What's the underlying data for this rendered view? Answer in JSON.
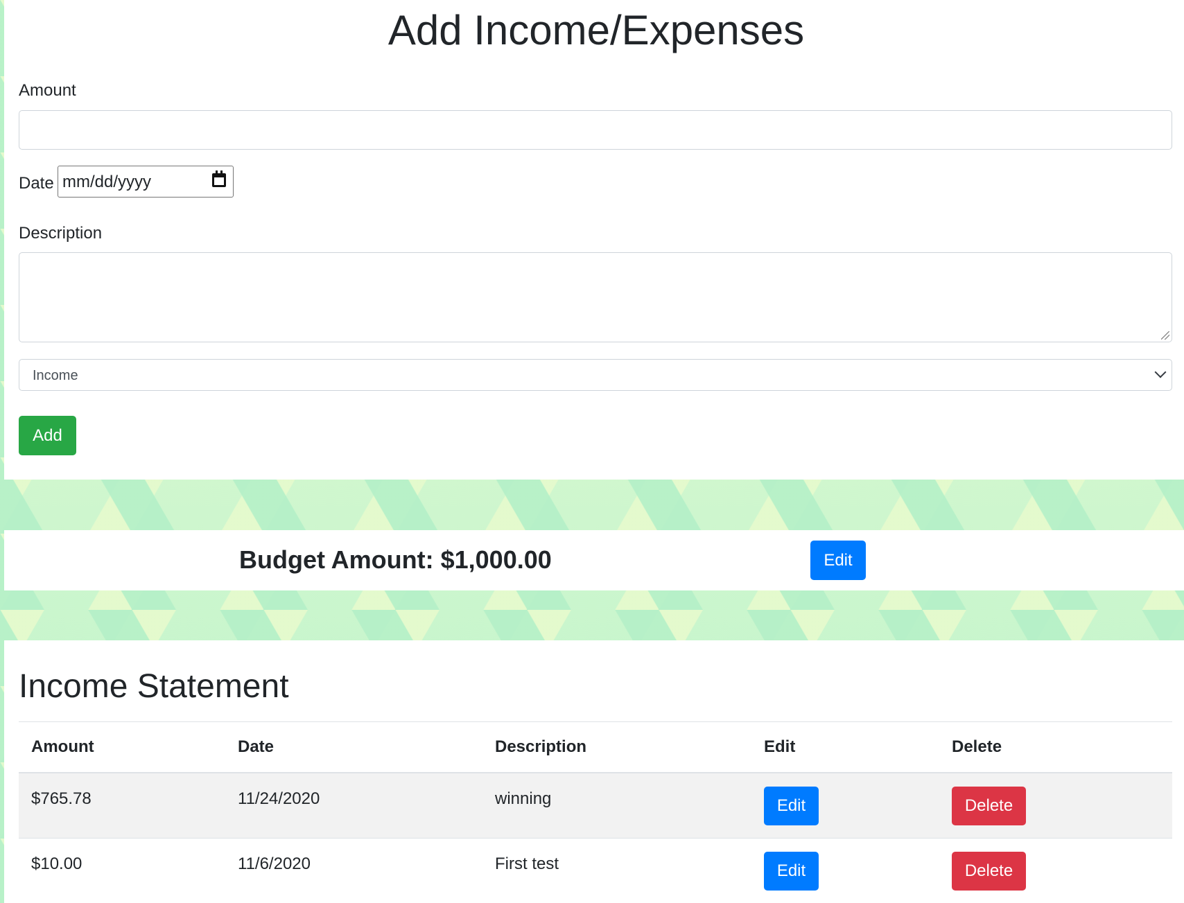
{
  "form": {
    "title": "Add Income/Expenses",
    "amount_label": "Amount",
    "amount_value": "",
    "date_label": "Date",
    "date_placeholder": "mm/dd/yyyy",
    "description_label": "Description",
    "description_value": "",
    "type_selected": "Income",
    "add_button": "Add"
  },
  "budget": {
    "text": "Budget Amount: $1,000.00",
    "edit_button": "Edit"
  },
  "statement": {
    "title": "Income Statement",
    "columns": [
      "Amount",
      "Date",
      "Description",
      "Edit",
      "Delete"
    ],
    "rows": [
      {
        "amount": "$765.78",
        "date": "11/24/2020",
        "description": "winning",
        "edit": "Edit",
        "delete": "Delete"
      },
      {
        "amount": "$10.00",
        "date": "11/6/2020",
        "description": "First test",
        "edit": "Edit",
        "delete": "Delete"
      }
    ]
  },
  "colors": {
    "success": "#28a745",
    "primary": "#007bff",
    "danger": "#dc3545"
  }
}
